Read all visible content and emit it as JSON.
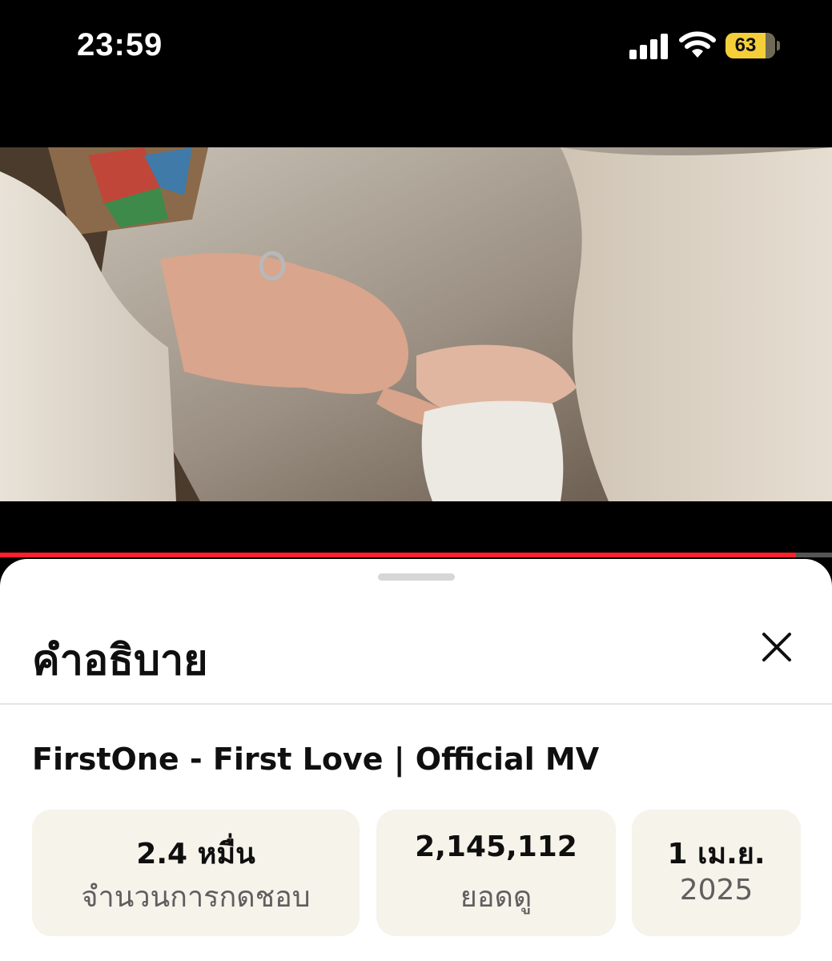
{
  "status_bar": {
    "time": "23:59",
    "battery_level": "63",
    "icons": [
      "cellular-signal-icon",
      "wifi-icon",
      "battery-icon"
    ]
  },
  "video": {
    "progress": 0.957,
    "progress_color": "#ff1f2d"
  },
  "sheet": {
    "title": "คำอธิบาย",
    "close_icon": "close-icon",
    "video_title": "FirstOne - First Love | Official MV",
    "stats": [
      {
        "value": "2.4 หมื่น",
        "label": "จำนวนการกดชอบ"
      },
      {
        "value": "2,145,112",
        "label": "ยอดดู"
      },
      {
        "value": "1 เม.ย.",
        "label": "2025"
      }
    ]
  },
  "colors": {
    "card_background": "#f6f3ea",
    "battery_yellow": "#f5cf3a"
  }
}
